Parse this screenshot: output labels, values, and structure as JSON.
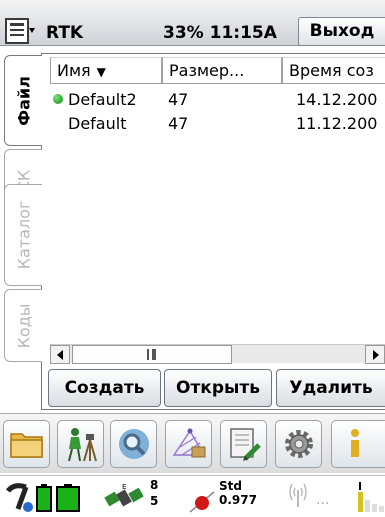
{
  "titlebar": {
    "app_title": "RTK",
    "battery_time": "33% 11:15A",
    "exit_label": "Выход"
  },
  "tabs": [
    {
      "label": "Файл",
      "active": true
    },
    {
      "label": "СК",
      "active": false
    },
    {
      "label": "Каталог",
      "active": false
    },
    {
      "label": "Коды",
      "active": false
    }
  ],
  "list": {
    "columns": [
      {
        "label": "Имя",
        "sorted": true
      },
      {
        "label": "Размер..."
      },
      {
        "label": "Время соз"
      }
    ],
    "rows": [
      {
        "name": "Default2",
        "size": "47",
        "time": "14.12.200",
        "active": true
      },
      {
        "name": "Default",
        "size": "47",
        "time": "11.12.200",
        "active": false
      }
    ]
  },
  "actions": {
    "create_label": "Создать",
    "open_label": "Открыть",
    "delete_label": "Удалить"
  },
  "toolbar": {
    "tools": [
      "folder-icon",
      "surveyor-tripod-icon",
      "magnifier-globe-icon",
      "grid-survey-icon",
      "notebook-pen-icon",
      "gear-icon",
      "info-icon"
    ]
  },
  "status": {
    "gps_sat_count_top": "8",
    "gps_sat_count_bottom": "5",
    "solution_label": "Std",
    "solution_value": "0.977",
    "radio_dots": "..."
  },
  "colors": {
    "active_dot": "#0a8a0a",
    "battery_green": "#19b219",
    "title_bar": "#d8dce1"
  }
}
